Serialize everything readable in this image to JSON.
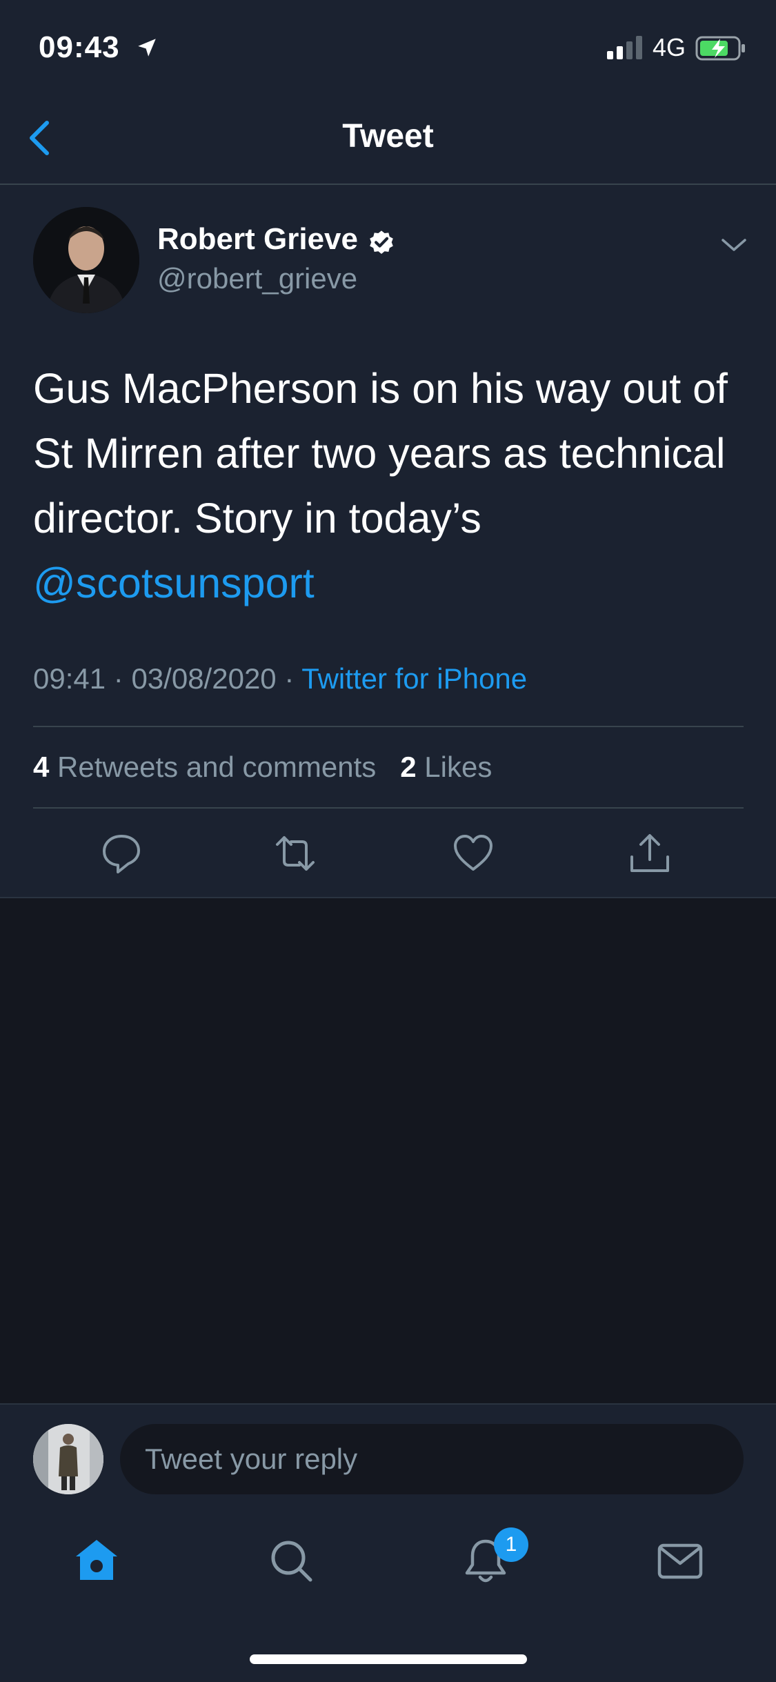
{
  "status_bar": {
    "time": "09:43",
    "network": "4G"
  },
  "nav": {
    "title": "Tweet"
  },
  "tweet": {
    "author_name": "Robert Grieve",
    "author_handle": "@robert_grieve",
    "text": "Gus MacPherson is on his way out of St Mirren after two years as technical director. Story in today’s",
    "mention": "@scotsunsport",
    "time": "09:41",
    "date": "03/08/2020",
    "separator": "·",
    "source": "Twitter for iPhone",
    "retweets_count": "4",
    "retweets_label": "Retweets and comments",
    "likes_count": "2",
    "likes_label": "Likes"
  },
  "reply": {
    "placeholder": "Tweet your reply"
  },
  "tab_bar": {
    "notifications_badge": "1"
  },
  "icons": [
    "location-arrow-icon",
    "signal-icon",
    "battery-charging-icon",
    "back-chevron-icon",
    "verified-badge-icon",
    "chevron-down-icon",
    "reply-icon",
    "retweet-icon",
    "like-icon",
    "share-icon",
    "home-icon",
    "search-icon",
    "bell-icon",
    "mail-icon"
  ],
  "colors": {
    "accent": "#1d9bf0",
    "background": "#1b2230",
    "muted_text": "#8899a6",
    "battery": "#4cd964"
  }
}
